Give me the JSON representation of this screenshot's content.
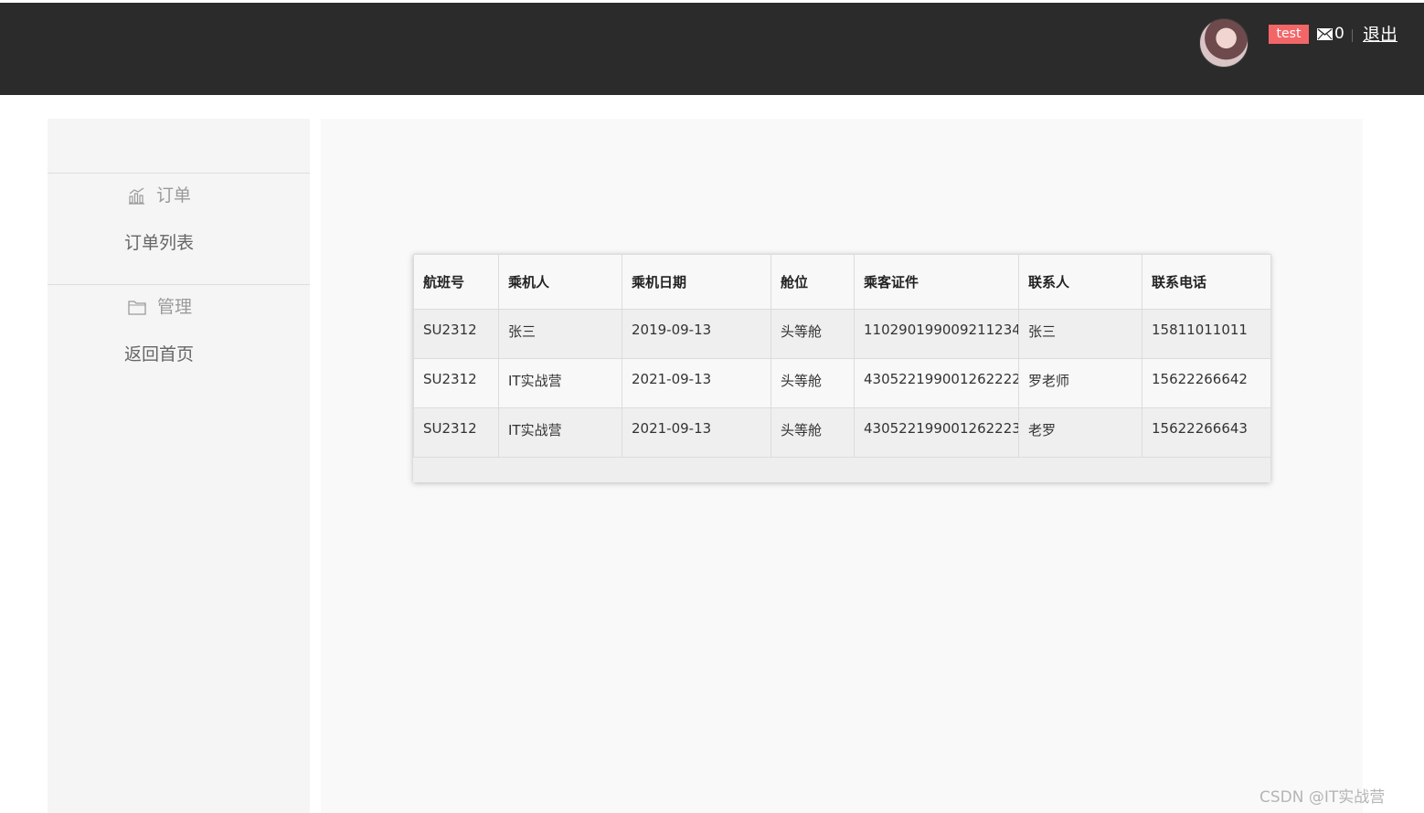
{
  "header": {
    "username": "test",
    "message_count": "0",
    "logout_label": "退出",
    "badge_color": "#f26667"
  },
  "sidebar": {
    "groups": [
      {
        "title": "订单",
        "icon": "chart-icon",
        "links": [
          "订单列表"
        ]
      },
      {
        "title": "管理",
        "icon": "folder-icon",
        "links": [
          "返回首页"
        ]
      }
    ]
  },
  "table": {
    "columns": [
      "航班号",
      "乘机人",
      "乘机日期",
      "舱位",
      "乘客证件",
      "联系人",
      "联系电话"
    ],
    "rows": [
      [
        "SU2312",
        "张三",
        "2019-09-13",
        "头等舱",
        "110290199009211234",
        "张三",
        "15811011011"
      ],
      [
        "SU2312",
        "IT实战营",
        "2021-09-13",
        "头等舱",
        "430522199001262222",
        "罗老师",
        "15622266642"
      ],
      [
        "SU2312",
        "IT实战营",
        "2021-09-13",
        "头等舱",
        "430522199001262223",
        "老罗",
        "15622266643"
      ]
    ]
  },
  "watermark": "CSDN @IT实战营"
}
